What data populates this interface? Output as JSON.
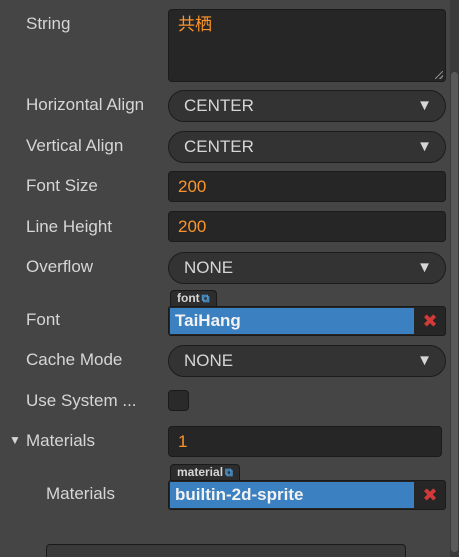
{
  "properties": {
    "string": {
      "label": "String",
      "value": "共栖"
    },
    "horizontal_align": {
      "label": "Horizontal Align",
      "value": "CENTER",
      "arrow": "▼"
    },
    "vertical_align": {
      "label": "Vertical Align",
      "value": "CENTER",
      "arrow": "▼"
    },
    "font_size": {
      "label": "Font Size",
      "value": "200"
    },
    "line_height": {
      "label": "Line Height",
      "value": "200"
    },
    "overflow": {
      "label": "Overflow",
      "value": "NONE",
      "arrow": "▼"
    },
    "font": {
      "label": "Font",
      "tag": "font",
      "value": "TaiHang",
      "clear": "✖"
    },
    "cache_mode": {
      "label": "Cache Mode",
      "value": "NONE",
      "arrow": "▼"
    },
    "use_system_font": {
      "label": "Use System ...",
      "checked": false
    },
    "materials": {
      "label": "Materials",
      "fold_arrow": "▼",
      "count": "1",
      "item": {
        "label": "Materials",
        "tag": "material",
        "value": "builtin-2d-sprite",
        "clear": "✖"
      }
    }
  },
  "icons": {
    "link_icon": "⧉"
  },
  "colors": {
    "accent": "#fd942b",
    "asset_highlight": "#3b80c0",
    "clear_red": "#d23a3a",
    "background": "#454545"
  }
}
